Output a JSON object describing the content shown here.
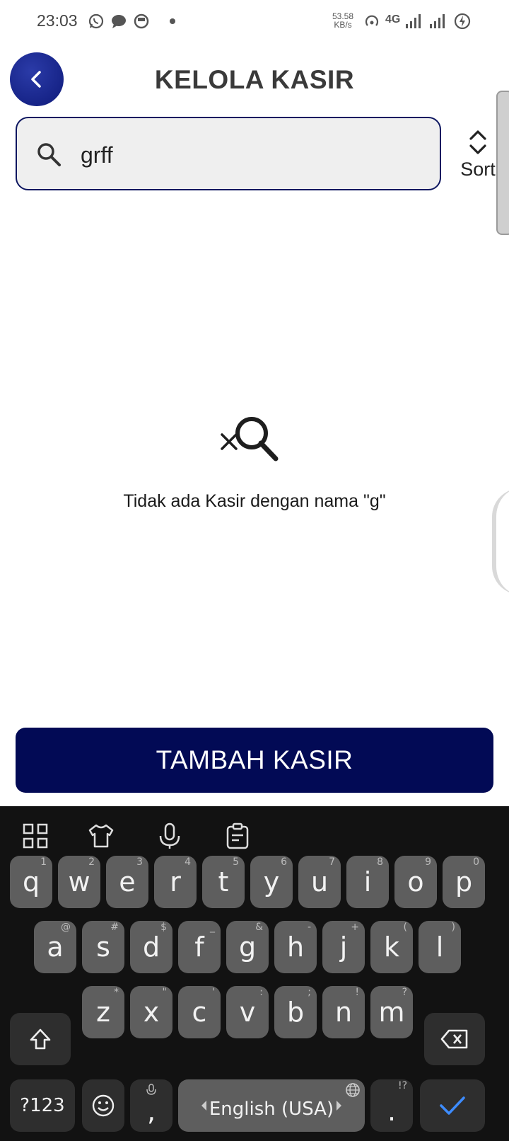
{
  "status": {
    "time": "23:03",
    "net_speed_value": "53.58",
    "net_speed_unit": "KB/s",
    "network_type": "4G"
  },
  "header": {
    "title": "KELOLA KASIR"
  },
  "search": {
    "value": "grff"
  },
  "sort": {
    "label": "Sort"
  },
  "empty_state": {
    "message": "Tidak ada Kasir dengan nama \"g\""
  },
  "actions": {
    "add_label": "TAMBAH KASIR"
  },
  "keyboard": {
    "row1": [
      {
        "k": "q",
        "h": "1"
      },
      {
        "k": "w",
        "h": "2"
      },
      {
        "k": "e",
        "h": "3"
      },
      {
        "k": "r",
        "h": "4"
      },
      {
        "k": "t",
        "h": "5"
      },
      {
        "k": "y",
        "h": "6"
      },
      {
        "k": "u",
        "h": "7"
      },
      {
        "k": "i",
        "h": "8"
      },
      {
        "k": "o",
        "h": "9"
      },
      {
        "k": "p",
        "h": "0"
      }
    ],
    "row2": [
      {
        "k": "a",
        "h": "@"
      },
      {
        "k": "s",
        "h": "#"
      },
      {
        "k": "d",
        "h": "$"
      },
      {
        "k": "f",
        "h": "_"
      },
      {
        "k": "g",
        "h": "&"
      },
      {
        "k": "h",
        "h": "-"
      },
      {
        "k": "j",
        "h": "+"
      },
      {
        "k": "k",
        "h": "("
      },
      {
        "k": "l",
        "h": ")"
      }
    ],
    "row3": [
      {
        "k": "z",
        "h": "*"
      },
      {
        "k": "x",
        "h": "\""
      },
      {
        "k": "c",
        "h": "'"
      },
      {
        "k": "v",
        "h": ":"
      },
      {
        "k": "b",
        "h": ";"
      },
      {
        "k": "n",
        "h": "!"
      },
      {
        "k": "m",
        "h": "?"
      }
    ],
    "symbols_label": "?123",
    "comma": ",",
    "space_label": "English (USA)",
    "period": ".",
    "period_hint": "!?"
  },
  "colors": {
    "primary": "#020a55",
    "back_button": "#1a278f",
    "keyboard_bg": "#121212",
    "key_bg": "#5e5e5e"
  }
}
